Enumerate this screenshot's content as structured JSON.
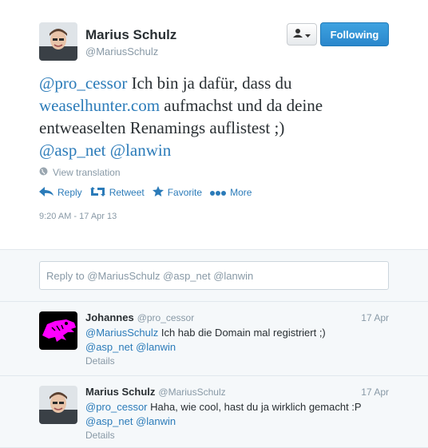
{
  "main_tweet": {
    "name": "Marius Schulz",
    "handle": "@MariusSchulz",
    "follow_label": "Following",
    "text_lines": [
      [
        {
          "t": "@pro_cessor",
          "link": true
        },
        {
          "t": " Ich bin ja dafür, dass du",
          "link": false
        }
      ],
      [
        {
          "t": "weaselhunter.com",
          "link": true
        },
        {
          "t": " aufmachst und da deine",
          "link": false
        }
      ],
      [
        {
          "t": "entweaselten Renamings auflistest ;)",
          "link": false
        }
      ],
      [
        {
          "t": "@asp_net",
          "link": true
        },
        {
          "t": " ",
          "link": false
        },
        {
          "t": "@lanwin",
          "link": true
        }
      ]
    ],
    "view_translation": "View translation",
    "actions": {
      "reply": "Reply",
      "retweet": "Retweet",
      "favorite": "Favorite",
      "more": "More"
    },
    "timestamp": "9:20 AM - 17 Apr 13"
  },
  "reply_box": {
    "placeholder": "Reply to @MariusSchulz @asp_net @lanwin"
  },
  "replies": [
    {
      "name": "Johannes",
      "handle": "@pro_cessor",
      "date": "17 Apr",
      "line1": [
        {
          "t": "@MariusSchulz",
          "link": true
        },
        {
          "t": " Ich hab die Domain mal registriert ;)",
          "link": false
        }
      ],
      "line2": [
        {
          "t": "@asp_net",
          "link": true
        },
        {
          "t": " ",
          "link": false
        },
        {
          "t": "@lanwin",
          "link": true
        }
      ],
      "details": "Details"
    },
    {
      "name": "Marius Schulz",
      "handle": "@MariusSchulz",
      "date": "17 Apr",
      "line1": [
        {
          "t": "@pro_cessor",
          "link": true
        },
        {
          "t": " Haha, wie cool, hast du ja wirklich gemacht :P",
          "link": false
        }
      ],
      "line2": [
        {
          "t": "@asp_net",
          "link": true
        },
        {
          "t": " ",
          "link": false
        },
        {
          "t": "@lanwin",
          "link": true
        }
      ],
      "details": "Details"
    }
  ],
  "colors": {
    "link": "#2b7bb9",
    "follow_button": "#2a87cc",
    "muted": "#8899a6",
    "dino_avatar": "#ff00ff"
  }
}
